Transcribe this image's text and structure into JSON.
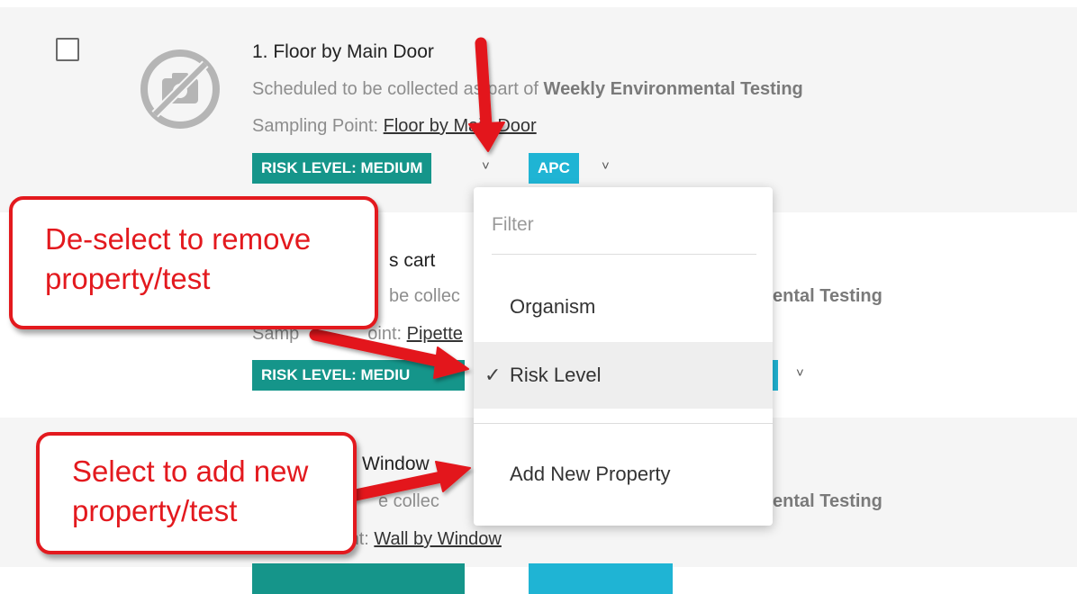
{
  "items": [
    {
      "title": "1. Floor by Main Door",
      "scheduled_prefix": "Scheduled to be collected as part of ",
      "scheduled_plan": "Weekly Environmental Testing",
      "sampling_prefix": "Sampling Point: ",
      "sampling_value": "Floor by Main Door",
      "risk_tag": "RISK LEVEL: MEDIUM",
      "apc_tag": "APC"
    },
    {
      "title_fragment": "s cart",
      "scheduled_fragment": "be collec",
      "plan_fragment": "ental Testing",
      "sampling_fragment_a": "Samp",
      "sampling_fragment_b": "oint: ",
      "sampling_value_fragment": "Pipette",
      "risk_tag_fragment": "RISK LEVEL: MEDIU"
    },
    {
      "title_fragment": "Window",
      "scheduled_fragment": "e collec",
      "plan_fragment": "ental Testing",
      "sampling_fragment": "oint: ",
      "sampling_value": "Wall by Window"
    }
  ],
  "dropdown": {
    "filter_placeholder": "Filter",
    "options": [
      {
        "label": "Organism",
        "checked": false
      },
      {
        "label": "Risk Level",
        "checked": true
      }
    ],
    "check_glyph": "✓",
    "add_new": "Add New Property"
  },
  "callouts": {
    "deselect_line1": "De-select to remove",
    "deselect_line2": "property/test",
    "select_line1": "Select to add new",
    "select_line2": "property/test"
  },
  "chevron": "˅",
  "colors": {
    "risk_tag": "#15958a",
    "apc_tag": "#1fb4d4",
    "callout_red": "#e3191e"
  }
}
